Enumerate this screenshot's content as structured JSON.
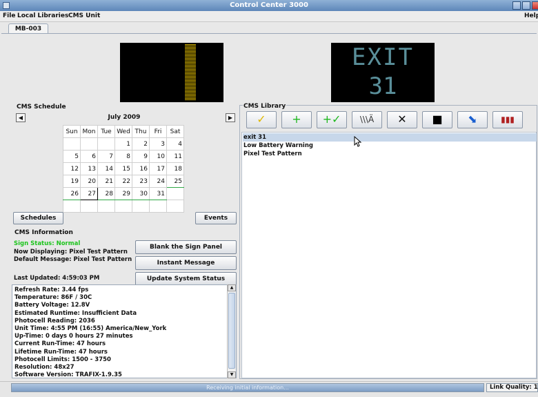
{
  "window": {
    "title": "Control Center 3000"
  },
  "menu": [
    "File",
    "Local Libraries",
    "CMS Unit"
  ],
  "menu_help": "Help",
  "tab": "MB-003",
  "preview2": {
    "line1": "EXIT",
    "line2": "31",
    "color": "#5a8f9a"
  },
  "schedule": {
    "label": "CMS Schedule",
    "month": "July 2009",
    "days": [
      "Sun",
      "Mon",
      "Tue",
      "Wed",
      "Thu",
      "Fri",
      "Sat"
    ],
    "weeks": [
      [
        "",
        "",
        "",
        "1",
        "2",
        "3",
        "4"
      ],
      [
        "5",
        "6",
        "7",
        "8",
        "9",
        "10",
        "11"
      ],
      [
        "12",
        "13",
        "14",
        "15",
        "16",
        "17",
        "18"
      ],
      [
        "19",
        "20",
        "21",
        "22",
        "23",
        "24",
        "25"
      ],
      [
        "26",
        "27",
        "28",
        "29",
        "30",
        "31",
        ""
      ],
      [
        "",
        "",
        "",
        "",
        "",
        "",
        ""
      ]
    ],
    "today": "27",
    "schedules_btn": "Schedules",
    "events_btn": "Events"
  },
  "info": {
    "label": "CMS Information",
    "sign_status": "Sign Status: Normal",
    "now_displaying": "Now Displaying: Pixel Test Pattern",
    "default_message": "Default Message: Pixel Test Pattern",
    "last_updated": "Last Updated: 4:59:03 PM",
    "blank_btn": "Blank the Sign Panel",
    "instant_btn": "Instant Message",
    "update_btn": "Update System Status",
    "status_color": "#1cc41c"
  },
  "log": [
    "Refresh Rate: 3.44 fps",
    "Temperature: 86F / 30C",
    "Battery Voltage: 12.8V",
    "Estimated Runtime: Insufficient Data",
    "Photocell Reading: 2036",
    "Unit Time: 4:55 PM (16:55) America/New_York",
    "Up-Time: 0 days 0 hours 27 minutes",
    "Current Run-Time: 47 hours",
    "Lifetime Run-Time: 47 hours",
    "Photocell Limits: 1500 - 3750",
    "Resolution: 48x27",
    "Software Version: TRAFIX-1.9.35"
  ],
  "library": {
    "label": "CMS Library",
    "items": [
      "exit 31",
      "Low Battery Warning",
      "Pixel Test Pattern"
    ],
    "toolbar": [
      {
        "name": "activate-check-icon",
        "glyph": "✓",
        "color": "#e0b800"
      },
      {
        "name": "add-plus-icon",
        "glyph": "+",
        "color": "#1eb81e"
      },
      {
        "name": "add-activate-icon",
        "glyph": "+✓",
        "color": "#1eb81e"
      },
      {
        "name": "edit-message-icon",
        "glyph": "\\\\\\Ä",
        "color": "#333333"
      },
      {
        "name": "delete-x-icon",
        "glyph": "✕",
        "color": "#111111"
      },
      {
        "name": "blank-square-icon",
        "glyph": "■",
        "color": "#000000"
      },
      {
        "name": "send-arrow-icon",
        "glyph": "⬊",
        "color": "#1a5fd0"
      },
      {
        "name": "library-books-icon",
        "glyph": "▮▮▮",
        "color": "#b02020"
      }
    ]
  },
  "status": {
    "progress_text": "Receiving initial information...",
    "link_quality": "Link Quality: 1"
  }
}
